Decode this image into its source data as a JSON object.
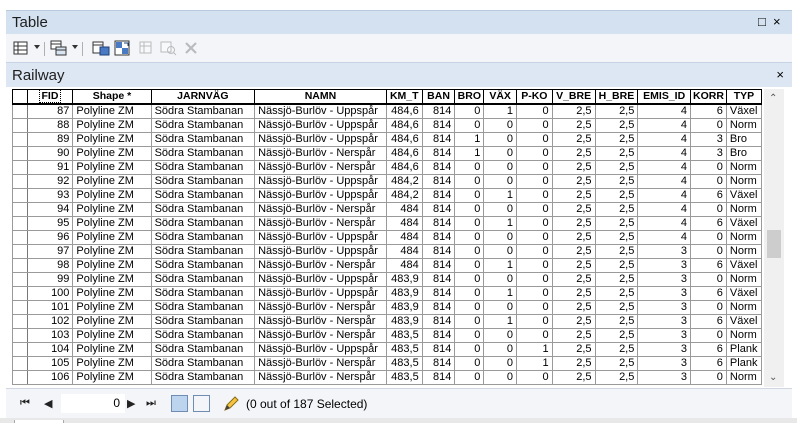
{
  "window": {
    "title": "Table",
    "maximize_glyph": "□",
    "close_glyph": "×"
  },
  "toolbar": {
    "icons": [
      "table-options-icon",
      "related-tables-icon",
      "select-by-attributes-icon",
      "switch-selection-icon",
      "clear-selection-icon",
      "zoom-to-selected-icon",
      "delete-selected-icon"
    ]
  },
  "tab": {
    "name": "Railway",
    "close_glyph": "×"
  },
  "grid": {
    "columns": [
      "FID",
      "Shape *",
      "JARNVÄG",
      "NAMN",
      "KM_T",
      "BAN",
      "BRO",
      "VÄX",
      "P-KO",
      "V_BRE",
      "H_BRE",
      "EMIS_ID",
      "KORR",
      "TYP"
    ],
    "rows": [
      [
        "87",
        "Polyline ZM",
        "Södra Stambanan",
        "Nässjö-Burlöv - Uppspår",
        "484,6",
        "814",
        "0",
        "1",
        "0",
        "2,5",
        "2,5",
        "4",
        "6",
        "Växel"
      ],
      [
        "88",
        "Polyline ZM",
        "Södra Stambanan",
        "Nässjö-Burlöv - Uppspår",
        "484,6",
        "814",
        "0",
        "0",
        "0",
        "2,5",
        "2,5",
        "4",
        "0",
        "Norm"
      ],
      [
        "89",
        "Polyline ZM",
        "Södra Stambanan",
        "Nässjö-Burlöv - Uppspår",
        "484,6",
        "814",
        "1",
        "0",
        "0",
        "2,5",
        "2,5",
        "4",
        "3",
        "Bro"
      ],
      [
        "90",
        "Polyline ZM",
        "Södra Stambanan",
        "Nässjö-Burlöv - Nerspår",
        "484,6",
        "814",
        "1",
        "0",
        "0",
        "2,5",
        "2,5",
        "4",
        "3",
        "Bro"
      ],
      [
        "91",
        "Polyline ZM",
        "Södra Stambanan",
        "Nässjö-Burlöv - Nerspår",
        "484,6",
        "814",
        "0",
        "0",
        "0",
        "2,5",
        "2,5",
        "4",
        "0",
        "Norm"
      ],
      [
        "92",
        "Polyline ZM",
        "Södra Stambanan",
        "Nässjö-Burlöv - Uppspår",
        "484,2",
        "814",
        "0",
        "0",
        "0",
        "2,5",
        "2,5",
        "4",
        "0",
        "Norm"
      ],
      [
        "93",
        "Polyline ZM",
        "Södra Stambanan",
        "Nässjö-Burlöv - Uppspår",
        "484,2",
        "814",
        "0",
        "1",
        "0",
        "2,5",
        "2,5",
        "4",
        "6",
        "Växel"
      ],
      [
        "94",
        "Polyline ZM",
        "Södra Stambanan",
        "Nässjö-Burlöv - Nerspår",
        "484",
        "814",
        "0",
        "0",
        "0",
        "2,5",
        "2,5",
        "4",
        "0",
        "Norm"
      ],
      [
        "95",
        "Polyline ZM",
        "Södra Stambanan",
        "Nässjö-Burlöv - Nerspår",
        "484",
        "814",
        "0",
        "1",
        "0",
        "2,5",
        "2,5",
        "4",
        "6",
        "Växel"
      ],
      [
        "96",
        "Polyline ZM",
        "Södra Stambanan",
        "Nässjö-Burlöv - Uppspår",
        "484",
        "814",
        "0",
        "0",
        "0",
        "2,5",
        "2,5",
        "4",
        "0",
        "Norm"
      ],
      [
        "97",
        "Polyline ZM",
        "Södra Stambanan",
        "Nässjö-Burlöv - Uppspår",
        "484",
        "814",
        "0",
        "0",
        "0",
        "2,5",
        "2,5",
        "3",
        "0",
        "Norm"
      ],
      [
        "98",
        "Polyline ZM",
        "Södra Stambanan",
        "Nässjö-Burlöv - Nerspår",
        "484",
        "814",
        "0",
        "1",
        "0",
        "2,5",
        "2,5",
        "3",
        "6",
        "Växel"
      ],
      [
        "99",
        "Polyline ZM",
        "Södra Stambanan",
        "Nässjö-Burlöv - Uppspår",
        "483,9",
        "814",
        "0",
        "0",
        "0",
        "2,5",
        "2,5",
        "3",
        "0",
        "Norm"
      ],
      [
        "100",
        "Polyline ZM",
        "Södra Stambanan",
        "Nässjö-Burlöv - Uppspår",
        "483,9",
        "814",
        "0",
        "1",
        "0",
        "2,5",
        "2,5",
        "3",
        "6",
        "Växel"
      ],
      [
        "101",
        "Polyline ZM",
        "Södra Stambanan",
        "Nässjö-Burlöv - Nerspår",
        "483,9",
        "814",
        "0",
        "0",
        "0",
        "2,5",
        "2,5",
        "3",
        "0",
        "Norm"
      ],
      [
        "102",
        "Polyline ZM",
        "Södra Stambanan",
        "Nässjö-Burlöv - Nerspår",
        "483,9",
        "814",
        "0",
        "1",
        "0",
        "2,5",
        "2,5",
        "3",
        "6",
        "Växel"
      ],
      [
        "103",
        "Polyline ZM",
        "Södra Stambanan",
        "Nässjö-Burlöv - Nerspår",
        "483,5",
        "814",
        "0",
        "0",
        "0",
        "2,5",
        "2,5",
        "3",
        "0",
        "Norm"
      ],
      [
        "104",
        "Polyline ZM",
        "Södra Stambanan",
        "Nässjö-Burlöv - Uppspår",
        "483,5",
        "814",
        "0",
        "0",
        "1",
        "2,5",
        "2,5",
        "3",
        "6",
        "Plank"
      ],
      [
        "105",
        "Polyline ZM",
        "Södra Stambanan",
        "Nässjö-Burlöv - Nerspår",
        "483,5",
        "814",
        "0",
        "0",
        "1",
        "2,5",
        "2,5",
        "3",
        "6",
        "Plank"
      ],
      [
        "106",
        "Polyline ZM",
        "Södra Stambanan",
        "Nässjö-Burlöv - Nerspår",
        "483,5",
        "814",
        "0",
        "0",
        "0",
        "2,5",
        "2,5",
        "3",
        "0",
        "Norm"
      ]
    ]
  },
  "status": {
    "first_glyph": "⏮",
    "prev_glyph": "◀",
    "record_value": "0",
    "next_glyph": "▶",
    "last_glyph": "⏭",
    "selection_text": "(0 out of 187 Selected)"
  }
}
